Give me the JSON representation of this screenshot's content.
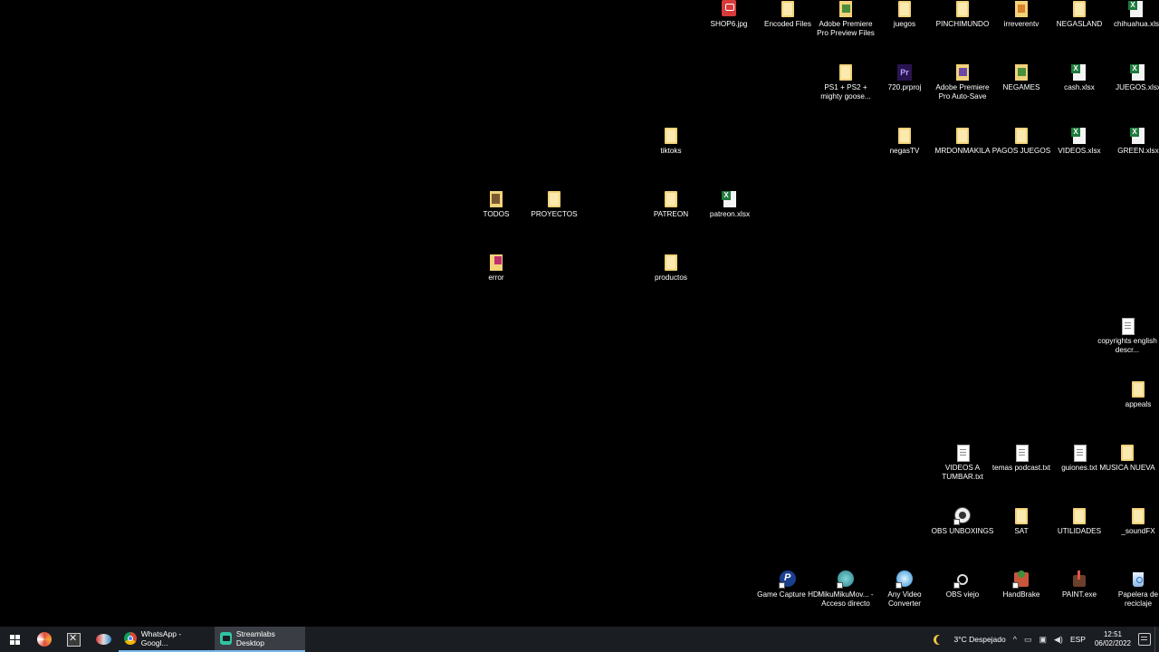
{
  "desktop": {
    "icons": {
      "shop6": "SHOP6.jpg",
      "encoded_files": "Encoded Files",
      "adobe_preview": "Adobe Premiere Pro Preview Files",
      "juegos": "juegos",
      "pinchimundo": "PINCHIMUNDO",
      "irreverentv": "irreverentv",
      "negasland": "NEGASLAND",
      "chihuahua": "chihuahua.xls",
      "ps1_ps2": "PS1 + PS2 + mighty goose...",
      "prproj_720": "720.prproj",
      "adobe_autosave": "Adobe Premiere Pro Auto-Save",
      "negames": "NEGAMES",
      "cash": "cash.xlsx",
      "juegos_xlsx": "JUEGOS.xlsx",
      "tiktoks": "tiktoks",
      "negastv": "negasTV",
      "mrdonmakila": "MRDONMAKILA",
      "pagos_juegos": "PAGOS JUEGOS",
      "videos_xlsx": "VIDEOS.xlsx",
      "green_xlsx": "GREEN.xlsx",
      "todos": "TODOS",
      "proyectos": "PROYECTOS",
      "patreon": "PATREON",
      "patreon_xlsx": "patreon.xlsx",
      "error": "error",
      "productos": "productos",
      "copyrights": "copyrights english descr...",
      "appeals": "appeals",
      "videos_tumbar": "VIDEOS A TUMBAR.txt",
      "temas_podcast": "temas podcast.txt",
      "guiones": "guiones.txt",
      "musica_nueva": "MUSICA NUEVA",
      "obs_unboxings": "OBS UNBOXINGS",
      "sat": "SAT",
      "utilidades": "UTILIDADES",
      "soundfx": "_soundFX",
      "game_capture": "Game Capture HD",
      "miku": "MikuMikuMov... - Acceso directo",
      "any_video": "Any Video Converter",
      "obs_viejo": "OBS viejo",
      "handbrake": "HandBrake",
      "paint": "PAINT.exe",
      "papelera": "Papelera de reciclaje"
    }
  },
  "taskbar": {
    "apps": {
      "whatsapp": "WhatsApp - Googl...",
      "streamlabs": "Streamlabs Desktop"
    },
    "tray": {
      "weather": "3°C  Despejado",
      "chevron": "^",
      "language": "ESP",
      "time": "12:51",
      "date": "06/02/2022"
    }
  }
}
